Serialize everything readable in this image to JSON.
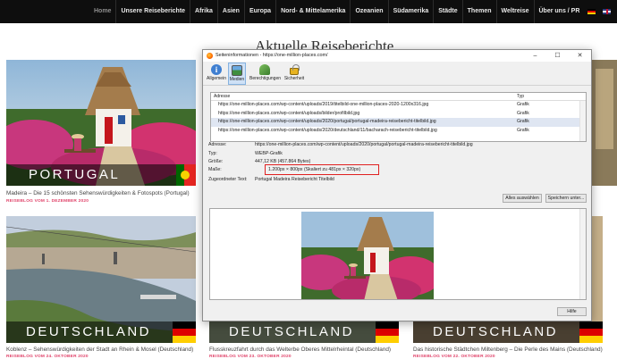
{
  "nav": {
    "items": [
      "Home",
      "Unsere Reiseberichte",
      "Afrika",
      "Asien",
      "Europa",
      "Nord- & Mittelamerika",
      "Ozeanien",
      "Südamerika",
      "Städte",
      "Themen",
      "Weltreise",
      "Über uns / PR"
    ],
    "active_index": 0,
    "lang_icons": [
      "german-flag-icon",
      "uk-flag-icon"
    ]
  },
  "section_title": "Aktuelle Reiseberichte",
  "articles": [
    {
      "label": "PORTUGAL",
      "caption": "Madeira – Die 15 schönsten Sehenswürdigkeiten & Fotospots (Portugal)",
      "meta": "REISEBLOG VOM 1. DEZEMBER 2020",
      "flag": "portugal-flag-icon"
    },
    {
      "label": "DEUTSCHLAND",
      "caption": "Koblenz – Sehenswürdigkeiten der Stadt an Rhein & Mosel (Deutschland)",
      "meta": "REISEBLOG VOM 24. OKTOBER 2020",
      "flag": "german-flag-icon"
    },
    {
      "label": "DEUTSCHLAND",
      "caption": "Flusskreuzfahrt durch das Welterbe Oberes Mittelrheintal (Deutschland)",
      "meta": "REISEBLOG VOM 23. OKTOBER 2020",
      "flag": "german-flag-icon"
    },
    {
      "label": "DEUTSCHLAND",
      "caption": "Das historische Städtchen Miltenberg – Die Perle des Mains (Deutschland)",
      "meta": "REISEBLOG VOM 22. OKTOBER 2020",
      "flag": "german-flag-icon"
    }
  ],
  "dialog": {
    "title": "Seiteninformationen - https://one-million-places.com/",
    "window_controls": {
      "minimize": "–",
      "maximize": "☐",
      "close": "✕"
    },
    "tabs": [
      {
        "label": "Allgemein",
        "icon": "info-icon",
        "selected": false
      },
      {
        "label": "Medien",
        "icon": "media-icon",
        "selected": true
      },
      {
        "label": "Berechtigungen",
        "icon": "permissions-icon",
        "selected": false
      },
      {
        "label": "Sicherheit",
        "icon": "lock-icon",
        "selected": false
      }
    ],
    "list": {
      "col_address": "Adresse",
      "col_type": "Typ",
      "rows": [
        {
          "address": "https://one-million-places.com/wp-content/uploads/2019/titelbild-one-million-places-2020-1200x316.jpg",
          "type": "Grafik",
          "selected": false
        },
        {
          "address": "https://one-million-places.com/wp-content/uploads/bilder/profilbild.jpg",
          "type": "Grafik",
          "selected": false
        },
        {
          "address": "https://one-million-places.com/wp-content/uploads/2020/portugal/portugal-madeira-reisebericht-titelbild.jpg",
          "type": "Grafik",
          "selected": true
        },
        {
          "address": "https://one-million-places.com/wp-content/uploads/2020/deutschland/11/bacharach-reisebericht-titelbild.jpg",
          "type": "Grafik",
          "selected": false
        }
      ]
    },
    "props": {
      "address_label": "Adresse:",
      "address_value": "https://one-million-places.com/wp-content/uploads/2020/portugal/portugal-madeira-reisebericht-titelbild.jpg",
      "type_label": "Typ:",
      "type_value": "WEBP-Grafik",
      "size_label": "Größe:",
      "size_value": "447,12 KB (457.864 Bytes)",
      "dims_label": "Maße:",
      "dims_value": "1.200px × 800px (Skaliert zu 481px × 320px)",
      "alt_label": "Zugeordneter Text:",
      "alt_value": "Portugal Madeira Reisebericht Titelbild"
    },
    "buttons": {
      "select_all": "Alles auswählen",
      "save_as": "Speichern unter...",
      "help": "Hilfe"
    }
  },
  "colors": {
    "nav_bg": "#0e0e0e",
    "meta_pink": "#e0436a",
    "highlight_red": "#e02020",
    "selected_row": "#dfe6f2"
  }
}
